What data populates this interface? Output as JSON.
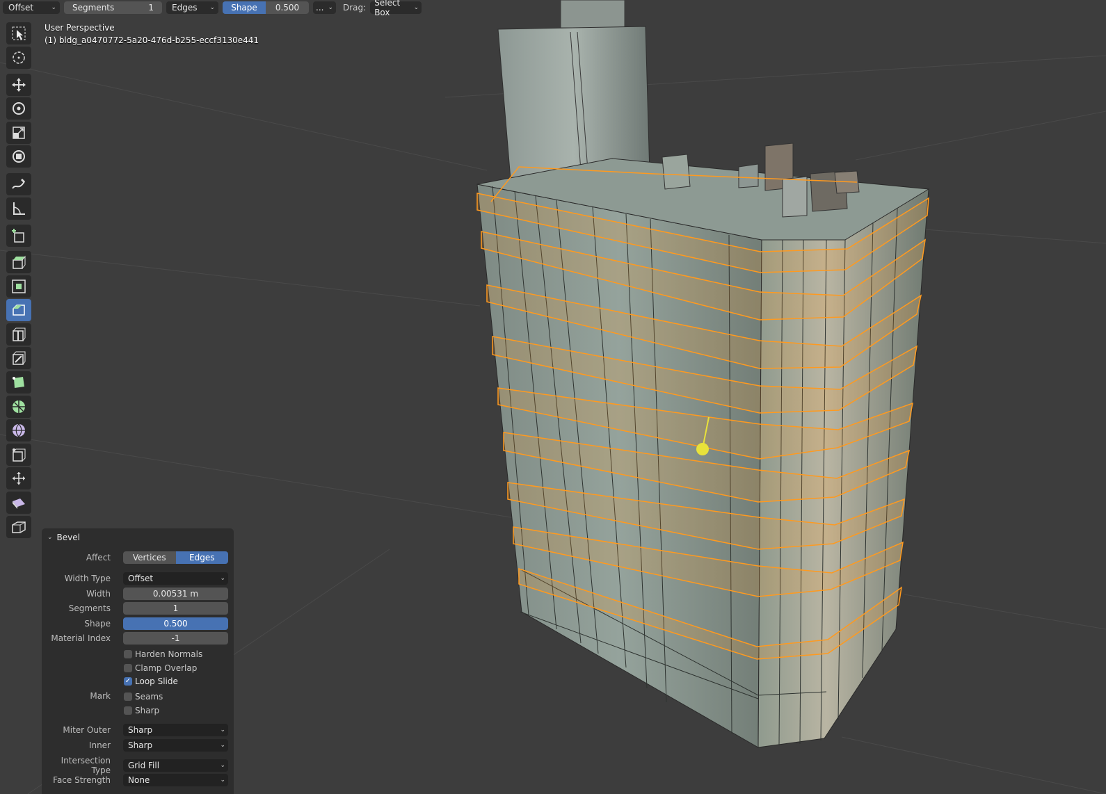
{
  "header": {
    "mode": "Offset",
    "segments_label": "Segments",
    "segments_value": "1",
    "affect": "Edges",
    "shape_label": "Shape",
    "shape_value": "0.500",
    "more": "...",
    "drag_label": "Drag:",
    "drag_value": "Select Box"
  },
  "overlay": {
    "view_name": "User Perspective",
    "object_name": "(1) bldg_a0470772-5a20-476d-b255-eccf3130e441"
  },
  "toolbar": {
    "tools": [
      "select-box",
      "cursor",
      "move",
      "rotate",
      "scale",
      "transform",
      "annotate",
      "measure",
      "add-cube",
      "extrude-region",
      "inset-faces",
      "bevel",
      "loop-cut",
      "knife",
      "poly-build",
      "spin",
      "smooth",
      "edge-slide",
      "shrink-fatten",
      "shear",
      "rip-region"
    ],
    "active_tool": "bevel"
  },
  "panel": {
    "title": "Bevel",
    "affect_label": "Affect",
    "affect_options": [
      "Vertices",
      "Edges"
    ],
    "affect_selected": "Edges",
    "width_type_label": "Width Type",
    "width_type_value": "Offset",
    "width_label": "Width",
    "width_value": "0.00531 m",
    "segments_label": "Segments",
    "segments_value": "1",
    "shape_label": "Shape",
    "shape_value": "0.500",
    "material_index_label": "Material Index",
    "material_index_value": "-1",
    "harden_normals": "Harden Normals",
    "harden_normals_checked": false,
    "clamp_overlap": "Clamp Overlap",
    "clamp_overlap_checked": false,
    "loop_slide": "Loop Slide",
    "loop_slide_checked": true,
    "mark_label": "Mark",
    "seams": "Seams",
    "seams_checked": false,
    "sharp": "Sharp",
    "sharp_checked": false,
    "miter_outer_label": "Miter Outer",
    "miter_outer_value": "Sharp",
    "inner_label": "Inner",
    "inner_value": "Sharp",
    "intersection_type_label": "Intersection Type",
    "intersection_type_value": "Grid Fill",
    "face_strength_label": "Face Strength",
    "face_strength_value": "None"
  },
  "colors": {
    "viewport_bg": "#3d3d3d",
    "accent": "#4772b3",
    "selection": "#ff9a1f",
    "gizmo": "#e8e23a"
  }
}
